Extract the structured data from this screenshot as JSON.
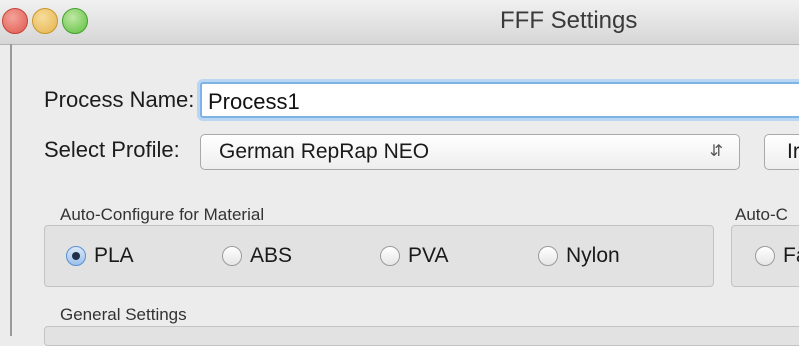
{
  "window": {
    "title": "FFF Settings"
  },
  "process_name": {
    "label": "Process Name:",
    "value": "Process1"
  },
  "profile": {
    "label": "Select Profile:",
    "selected": "German RepRap NEO",
    "side_button_label": "Ir"
  },
  "material_group": {
    "title": "Auto-Configure for Material",
    "options": [
      {
        "label": "PLA",
        "selected": true
      },
      {
        "label": "ABS",
        "selected": false
      },
      {
        "label": "PVA",
        "selected": false
      },
      {
        "label": "Nylon",
        "selected": false
      }
    ]
  },
  "second_group": {
    "title": "Auto-C",
    "options": [
      {
        "label": "Fa",
        "selected": false
      }
    ]
  },
  "general_settings": {
    "title": "General Settings"
  }
}
